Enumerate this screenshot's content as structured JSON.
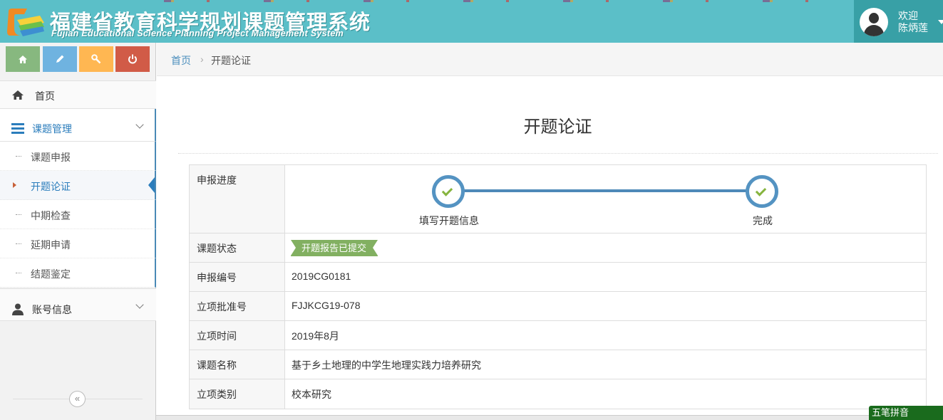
{
  "header": {
    "title_cn": "福建省教育科学规划课题管理系统",
    "title_en": "Fujian Educational Science Planning Project Management System",
    "user_greeting": "欢迎",
    "user_name": "陈炳莲",
    "bg_color": "#5bbfc8"
  },
  "shortcuts": [
    {
      "icon": "home-icon",
      "color": "#87b87f"
    },
    {
      "icon": "pencil-icon",
      "color": "#6fb3e0"
    },
    {
      "icon": "wrench-icon",
      "color": "#ffb752"
    },
    {
      "icon": "power-icon",
      "color": "#d15b47"
    }
  ],
  "sidebar": {
    "home_label": "首页",
    "course_mgmt_label": "课题管理",
    "sub_items": [
      {
        "label": "课题申报"
      },
      {
        "label": "开题论证",
        "active": true
      },
      {
        "label": "中期检查"
      },
      {
        "label": "延期申请"
      },
      {
        "label": "结题鉴定"
      }
    ],
    "account_label": "账号信息",
    "collapse_glyph": "«"
  },
  "breadcrumb": {
    "home": "首页",
    "separator": "›",
    "current": "开题论证"
  },
  "page": {
    "title": "开题论证"
  },
  "progress": {
    "label": "申报进度",
    "steps": [
      {
        "label": "填写开题信息",
        "done": true
      },
      {
        "label": "完成",
        "done": true
      }
    ]
  },
  "details": [
    {
      "key": "课题状态",
      "value": "开题报告已提交",
      "badge": true
    },
    {
      "key": "申报编号",
      "value": "2019CG0181"
    },
    {
      "key": "立项批准号",
      "value": "FJJKCG19-078"
    },
    {
      "key": "立项时间",
      "value": "2019年8月"
    },
    {
      "key": "课题名称",
      "value": "基于乡土地理的中学生地理实践力培养研究"
    },
    {
      "key": "立项类别",
      "value": "校本研究"
    }
  ],
  "ime": {
    "label": "五笔拼音"
  }
}
